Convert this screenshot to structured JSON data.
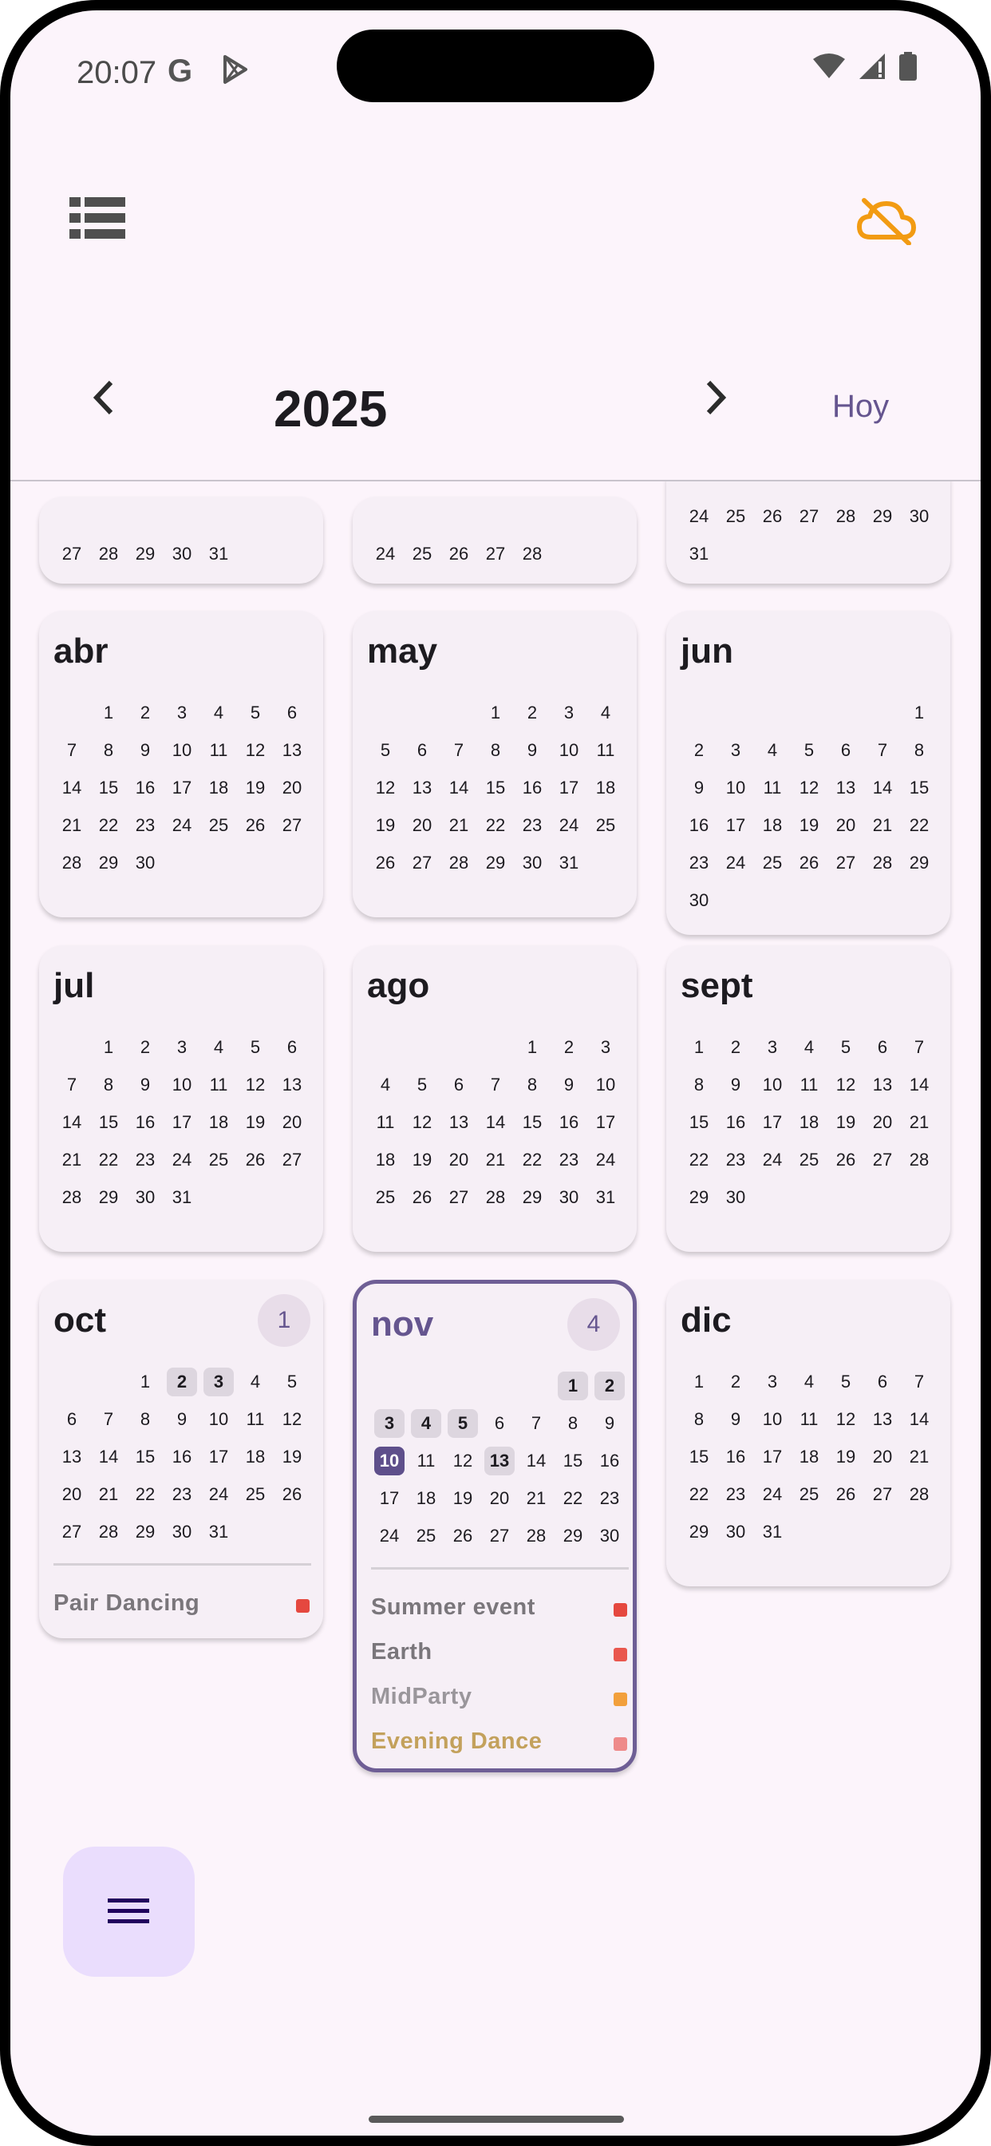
{
  "status": {
    "time": "20:07",
    "g_label": "G"
  },
  "header": {
    "year": "2025",
    "today_label": "Hoy"
  },
  "top_partial": [
    {
      "rows": [
        [
          "27",
          "28",
          "29",
          "30",
          "31"
        ]
      ]
    },
    {
      "rows": [
        [
          "24",
          "25",
          "26",
          "27",
          "28"
        ]
      ]
    },
    {
      "rows": [
        [
          "24",
          "25",
          "26",
          "27",
          "28",
          "29",
          "30"
        ],
        [
          "31"
        ]
      ]
    }
  ],
  "months": [
    {
      "name": "abr",
      "offset": 1,
      "days": 30
    },
    {
      "name": "may",
      "offset": 3,
      "days": 31
    },
    {
      "name": "jun",
      "offset": 6,
      "days": 30
    },
    {
      "name": "jul",
      "offset": 1,
      "days": 31
    },
    {
      "name": "ago",
      "offset": 4,
      "days": 31
    },
    {
      "name": "sept",
      "offset": 0,
      "days": 30
    },
    {
      "name": "oct",
      "offset": 2,
      "days": 31,
      "badge": "1",
      "event_days": [
        2,
        3
      ],
      "events": [
        {
          "name": "Pair Dancing",
          "color": "#e5483f"
        }
      ]
    },
    {
      "name": "nov",
      "offset": 5,
      "days": 30,
      "badge": "4",
      "selected": true,
      "event_days": [
        1,
        2,
        3,
        4,
        5,
        13
      ],
      "today": 10,
      "events": [
        {
          "name": "Summer event",
          "color": "#e5483f"
        },
        {
          "name": "Earth",
          "color": "#e9574e"
        },
        {
          "name": "MidParty",
          "color": "#f2a03c"
        },
        {
          "name": "Evening Dance",
          "color": "#ee8a8a",
          "text_color": "#c3a15c"
        }
      ]
    },
    {
      "name": "dic",
      "offset": 0,
      "days": 31
    }
  ],
  "colors": {
    "accent": "#65558f",
    "cloud_off": "#f29b12",
    "fab": "#eaddfd"
  },
  "icons": {
    "list": "list-view-icon",
    "cloud": "cloud-off-icon",
    "prev": "chevron-left-icon",
    "next": "chevron-right-icon",
    "menu": "menu-icon"
  }
}
